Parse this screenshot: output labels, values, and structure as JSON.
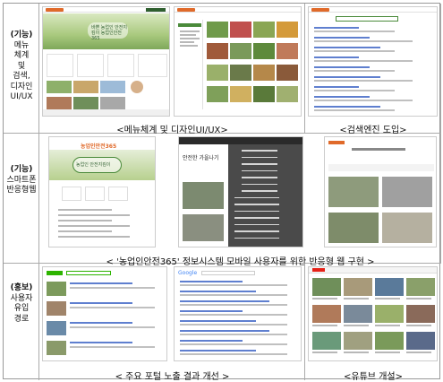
{
  "rows": [
    {
      "label_strong": "(기능)",
      "label_lines": [
        "메뉴",
        "체계",
        "및",
        "검색,",
        "디자인",
        "UI/UX"
      ],
      "captions": [
        "<메뉴체계 및 디자인UI/UX>",
        "<검색엔진 도입>"
      ]
    },
    {
      "label_strong": "(기능)",
      "label_lines": [
        "스마트폰",
        "반응형웹"
      ],
      "captions": [
        "< '농업인안전365' 정보시스템 모바일 사용자를 위한 반응형 웹 구현 >"
      ]
    },
    {
      "label_strong": "(홍보)",
      "label_lines": [
        "사용자",
        "유입",
        "경로"
      ],
      "captions": [
        "< 주요 포털 노출 결과 개선 >",
        "<유튜브 개설>"
      ]
    }
  ],
  "screens": {
    "home_banner_text": "바쁜 농업인 안전지킴이 농업인안전365",
    "mobile_site_name": "농업인안전365",
    "mobile_banner_text": "농업인 안전지킴이",
    "mobile_menu_title": "안전한 가을나기",
    "portal_logo": "Google"
  },
  "colors": {
    "accent_green": "#4a8a3a",
    "banner_green": "#a9c97e",
    "mobile_dark": "#3c3c3c",
    "blue_link": "#5f7fcf"
  }
}
